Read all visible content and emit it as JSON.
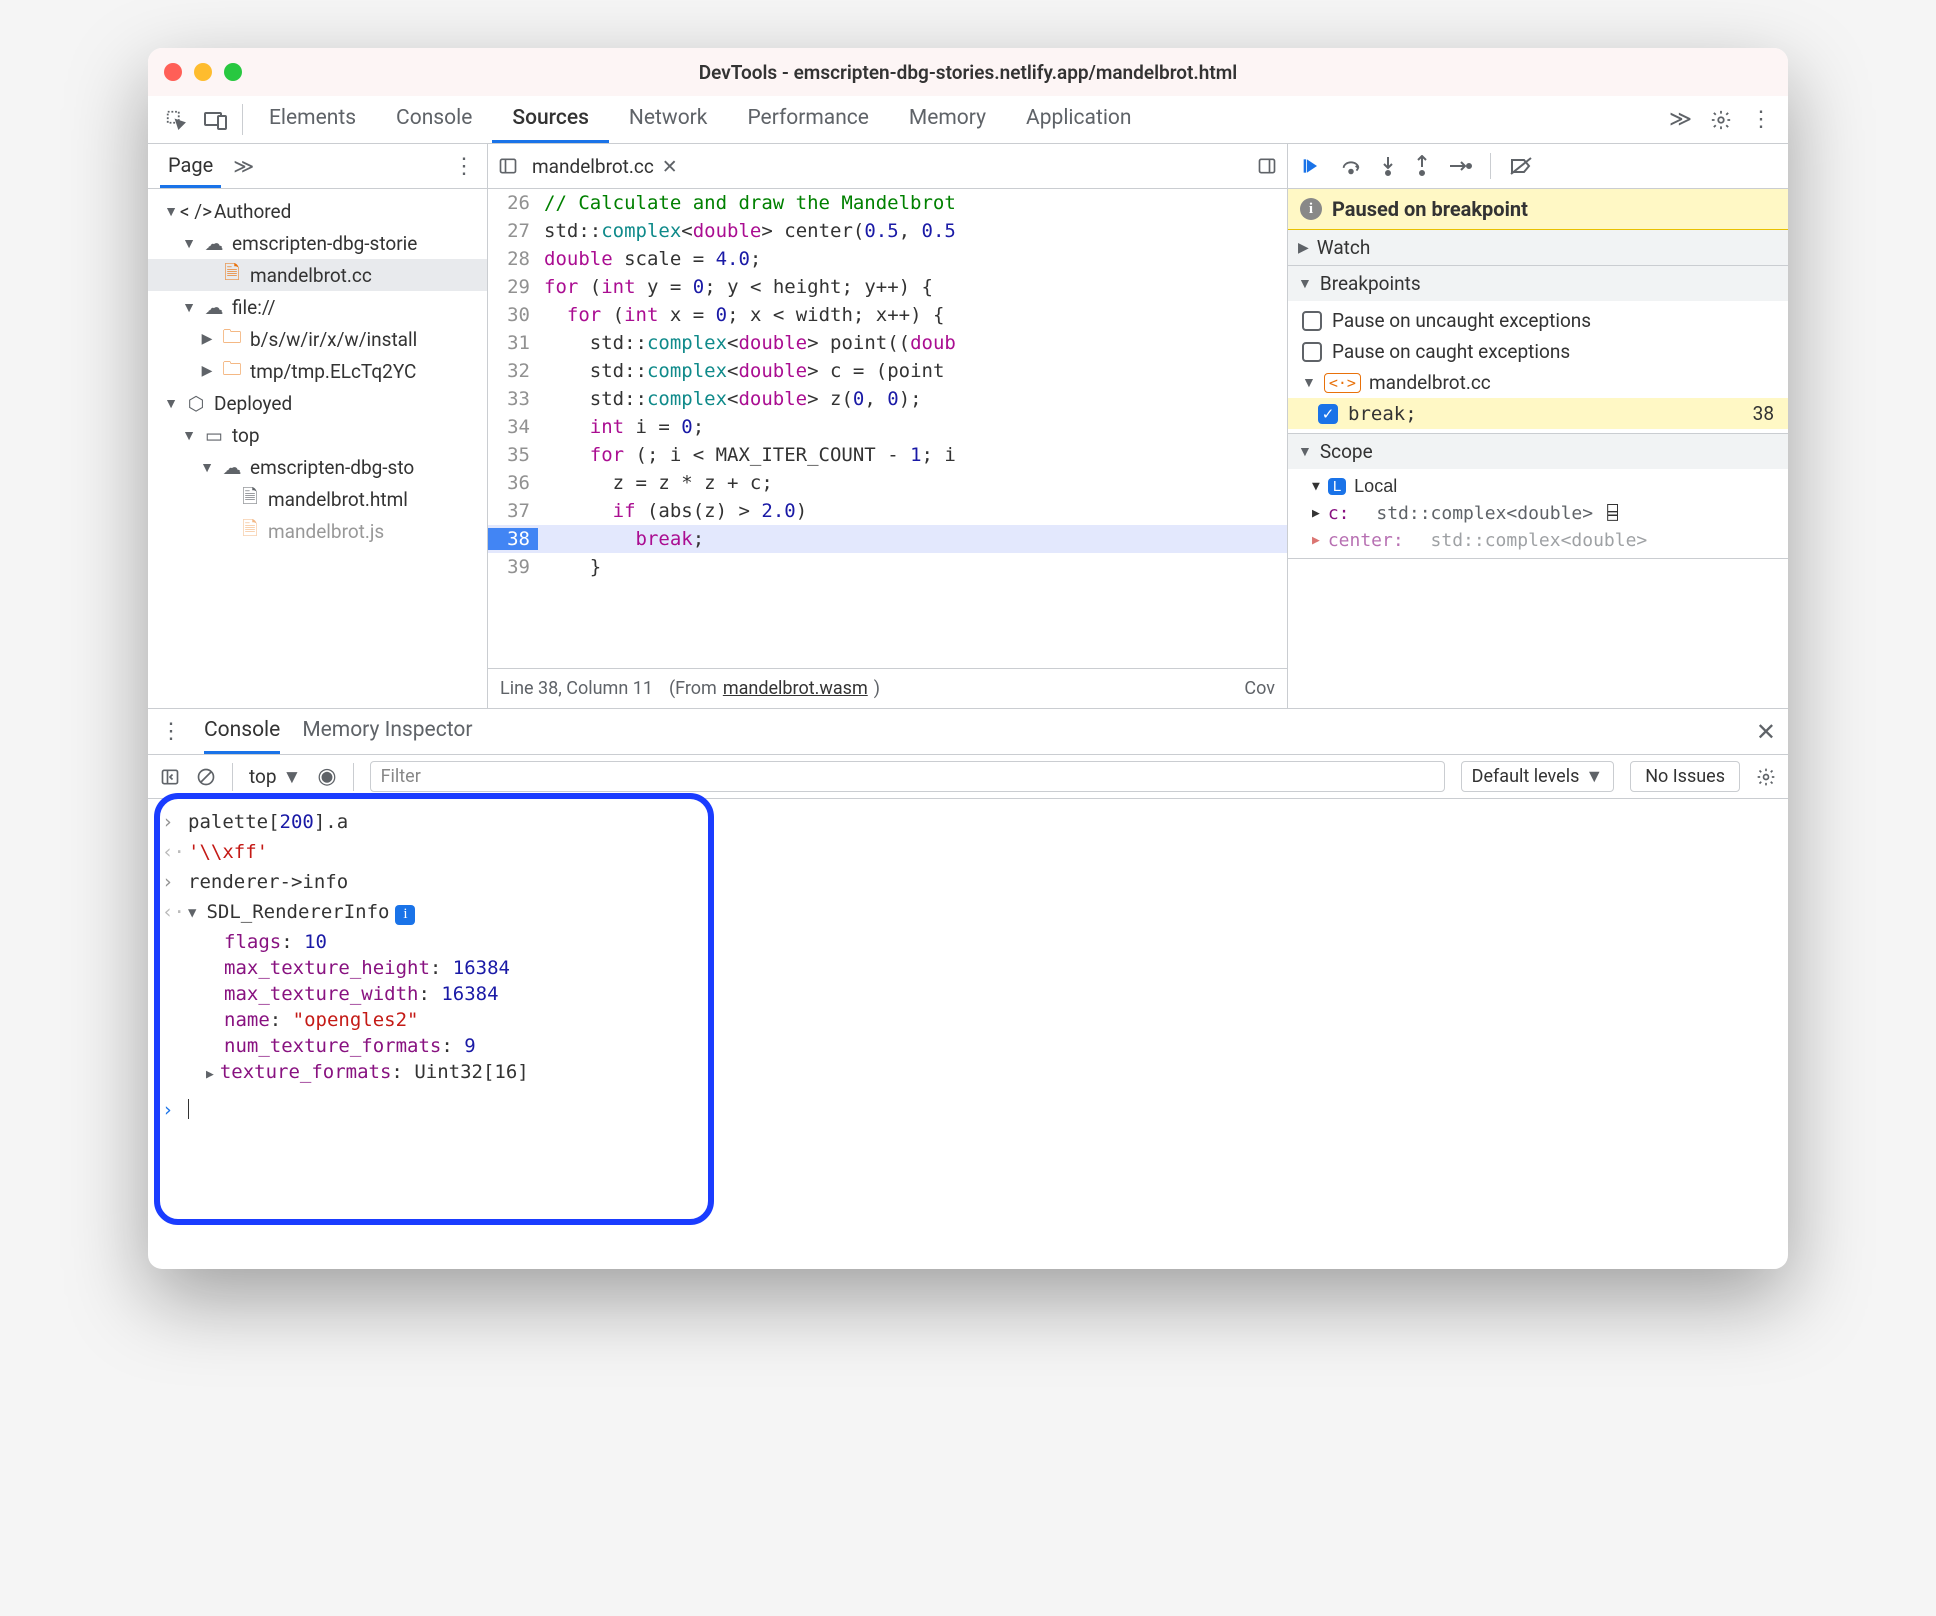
{
  "window": {
    "title": "DevTools - emscripten-dbg-stories.netlify.app/mandelbrot.html"
  },
  "tabs": [
    "Elements",
    "Console",
    "Sources",
    "Network",
    "Performance",
    "Memory",
    "Application"
  ],
  "active_tab": "Sources",
  "page_label": "Page",
  "tree": {
    "authored": "Authored",
    "origin1": "emscripten-dbg-storie",
    "file_cc": "mandelbrot.cc",
    "file_scheme": "file://",
    "path1": "b/s/w/ir/x/w/install",
    "path2": "tmp/tmp.ELcTq2YC",
    "deployed": "Deployed",
    "top": "top",
    "origin2": "emscripten-dbg-sto",
    "html": "mandelbrot.html",
    "js": "mandelbrot.js"
  },
  "editor": {
    "tab_name": "mandelbrot.cc",
    "lines": {
      "26": [
        [
          "cm",
          "// Calculate and draw the Mandelbrot"
        ]
      ],
      "27": [
        [
          "pun",
          "std::"
        ],
        [
          "ty",
          "complex"
        ],
        [
          "pun",
          "<"
        ],
        [
          "kw",
          "double"
        ],
        [
          "pun",
          "> center("
        ],
        [
          "nm",
          "0.5"
        ],
        [
          "pun",
          ", "
        ],
        [
          "nm",
          "0.5"
        ]
      ],
      "28": [
        [
          "kw",
          "double"
        ],
        [
          "pun",
          " scale = "
        ],
        [
          "nm",
          "4.0"
        ],
        [
          "pun",
          ";"
        ]
      ],
      "29": [
        [
          "kw",
          "for"
        ],
        [
          "pun",
          " ("
        ],
        [
          "kw",
          "int"
        ],
        [
          "pun",
          " y = "
        ],
        [
          "nm",
          "0"
        ],
        [
          "pun",
          "; y < height; y++) {"
        ]
      ],
      "30": [
        [
          "pun",
          "  "
        ],
        [
          "kw",
          "for"
        ],
        [
          "pun",
          " ("
        ],
        [
          "kw",
          "int"
        ],
        [
          "pun",
          " x = "
        ],
        [
          "nm",
          "0"
        ],
        [
          "pun",
          "; x < width; x++) {"
        ]
      ],
      "31": [
        [
          "pun",
          "    std::"
        ],
        [
          "ty",
          "complex"
        ],
        [
          "pun",
          "<"
        ],
        [
          "kw",
          "double"
        ],
        [
          "pun",
          "> point(("
        ],
        [
          "kw",
          "doub"
        ]
      ],
      "32": [
        [
          "pun",
          "    std::"
        ],
        [
          "ty",
          "complex"
        ],
        [
          "pun",
          "<"
        ],
        [
          "kw",
          "double"
        ],
        [
          "pun",
          "> c = (point "
        ]
      ],
      "33": [
        [
          "pun",
          "    std::"
        ],
        [
          "ty",
          "complex"
        ],
        [
          "pun",
          "<"
        ],
        [
          "kw",
          "double"
        ],
        [
          "pun",
          "> z("
        ],
        [
          "nm",
          "0"
        ],
        [
          "pun",
          ", "
        ],
        [
          "nm",
          "0"
        ],
        [
          "pun",
          ");"
        ]
      ],
      "34": [
        [
          "pun",
          "    "
        ],
        [
          "kw",
          "int"
        ],
        [
          "pun",
          " i = "
        ],
        [
          "nm",
          "0"
        ],
        [
          "pun",
          ";"
        ]
      ],
      "35": [
        [
          "pun",
          "    "
        ],
        [
          "kw",
          "for"
        ],
        [
          "pun",
          " (; i < MAX_ITER_COUNT - "
        ],
        [
          "nm",
          "1"
        ],
        [
          "pun",
          "; i"
        ]
      ],
      "36": [
        [
          "pun",
          "      z = z * z + c;"
        ]
      ],
      "37": [
        [
          "pun",
          "      "
        ],
        [
          "kw",
          "if"
        ],
        [
          "pun",
          " (abs(z) > "
        ],
        [
          "nm",
          "2.0"
        ],
        [
          "pun",
          ")"
        ]
      ],
      "38": [
        [
          "pun",
          "        "
        ],
        [
          "kw",
          "break"
        ],
        [
          "pun",
          ";"
        ]
      ],
      "39": [
        [
          "pun",
          "    }"
        ]
      ]
    },
    "highlight_line": 38,
    "status": {
      "pos": "Line 38, Column 11",
      "from_label": "(From ",
      "from_target": "mandelbrot.wasm",
      "from_close": ")",
      "cov": "Cov"
    }
  },
  "debug": {
    "paused": "Paused on breakpoint",
    "watch": "Watch",
    "breakpoints": "Breakpoints",
    "uncaught": "Pause on uncaught exceptions",
    "caught": "Pause on caught exceptions",
    "bp_file": "mandelbrot.cc",
    "bp_text": "break;",
    "bp_line": "38",
    "scope": "Scope",
    "local": "Local",
    "var_c": "c:",
    "var_c_type": "std::complex<double>",
    "var_center": "center:",
    "var_center_type": "std::complex<double>"
  },
  "drawer": {
    "tabs": [
      "Console",
      "Memory Inspector"
    ],
    "active": "Console",
    "context": "top",
    "filter_placeholder": "Filter",
    "levels": "Default levels",
    "issues": "No Issues"
  },
  "console": {
    "in1": "palette[200].a",
    "in1_idx": "200",
    "out1": "'\\\\xff'",
    "in2": "renderer->info",
    "obj_type": "SDL_RendererInfo",
    "props": {
      "flags": "10",
      "max_texture_height": "16384",
      "max_texture_width": "16384",
      "name": "\"opengles2\"",
      "num_texture_formats": "9",
      "texture_formats": "Uint32[16]"
    }
  }
}
